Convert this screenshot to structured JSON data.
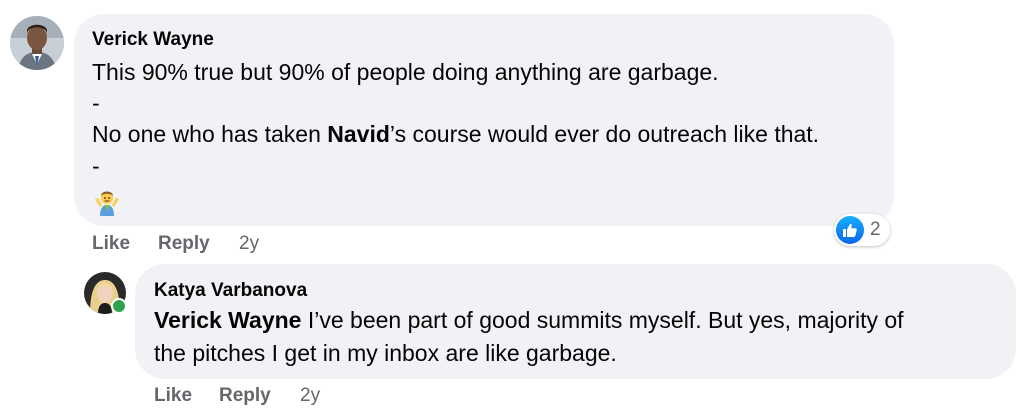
{
  "comments": [
    {
      "author": "Verick Wayne",
      "line1": "This 90% true but 90% of people doing anything are garbage.",
      "sep1": "-",
      "line3_before": "No one who has taken ",
      "line3_bold": "Navid",
      "line3_after": "’s course would ever do outreach like that.",
      "sep2": "-",
      "emoji": "shrugging-person-emoji",
      "reaction_icon": "like-icon",
      "reaction_count": "2",
      "actions": {
        "like": "Like",
        "reply": "Reply",
        "time": "2y"
      }
    },
    {
      "author": "Katya Varbanova",
      "mention": "Verick Wayne",
      "line1_after": " I’ve been part of good summits myself. But yes, majority of",
      "line2": "the pitches I get in my inbox are like garbage.",
      "online": true,
      "actions": {
        "like": "Like",
        "reply": "Reply",
        "time": "2y"
      }
    }
  ],
  "colors": {
    "bubble": "#f0f2f5",
    "text": "#050505",
    "muted": "#65676b",
    "like_blue": "#0a66e8",
    "online_green": "#31a24c"
  }
}
